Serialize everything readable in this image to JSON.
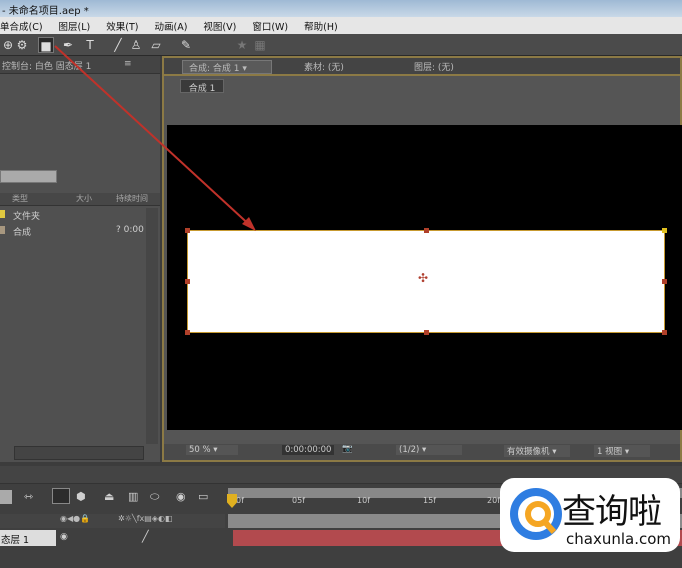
{
  "title": "- 未命名项目.aep *",
  "menu": [
    "单合成(C)",
    "图层(L)",
    "效果(T)",
    "动画(A)",
    "视图(V)",
    "窗口(W)",
    "帮助(H)"
  ],
  "left_panel": {
    "header": "控制台: 白色 固态层 1",
    "columns": [
      "类型",
      "大小",
      "持续时间"
    ],
    "items": [
      {
        "name": "文件夹",
        "duration": ""
      },
      {
        "name": "合成",
        "duration": "? 0:00"
      }
    ]
  },
  "comp_panel": {
    "tabs": [
      "合成: 合成 1",
      "素材: (无)",
      "图层: (无)"
    ],
    "subtab": "合成 1",
    "zoom": "50 %",
    "timecode": "0:00:00:00",
    "resolution": "(1/2)",
    "camera": "有效摄像机",
    "views": "1 视图"
  },
  "timeline": {
    "ticks": [
      "0f",
      "05f",
      "10f",
      "15f",
      "20f"
    ],
    "layer_name": "态层 1"
  },
  "watermark": {
    "brand": "查询啦",
    "url": "chaxunla.com"
  },
  "colors": {
    "accent": "#c79a30",
    "arrow": "#c0322a",
    "layer_bar": "#b24a4e"
  }
}
